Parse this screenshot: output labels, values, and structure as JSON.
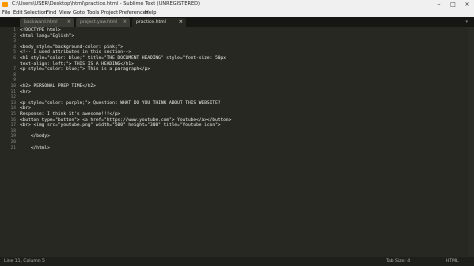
{
  "window": {
    "title": "C:\\Users\\USER\\Desktop\\html\\practice.html - Sublime Text (UNREGISTERED)"
  },
  "menu": [
    "File",
    "Edit",
    "Selection",
    "Find",
    "View",
    "Goto",
    "Tools",
    "Project",
    "Preferences",
    "Help"
  ],
  "tabs": [
    {
      "label": "backward.html",
      "active": false
    },
    {
      "label": "project.yaw.html",
      "active": false
    },
    {
      "label": "practice.html",
      "active": true
    }
  ],
  "editor": {
    "lines": [
      {
        "n": "1",
        "text": "<!DOCTYPE html>"
      },
      {
        "n": "2",
        "text": "<html lang=\"Eglish\">"
      },
      {
        "n": "3",
        "text": ""
      },
      {
        "n": "4",
        "text": "<body style=\"background-color: pink;\">"
      },
      {
        "n": "5",
        "text": "<!-- I used attributes in this section-->"
      },
      {
        "n": "6",
        "text": "<h1 style=\"color: blue;\" title=\"THE DOCUMENT HEADING\" style=\"font-size: 50px"
      },
      {
        "n": "",
        "text": "text-align: left;\"> THIS IS A HEADING</h1>"
      },
      {
        "n": "7",
        "text": "<p style=\"color: blue;\"> This is a paragraph</p>"
      },
      {
        "n": "8",
        "text": ""
      },
      {
        "n": "9",
        "text": ""
      },
      {
        "n": "10",
        "text": "<h2> PERSONAL PREP TIME</h2>"
      },
      {
        "n": "11",
        "text": "<hr>"
      },
      {
        "n": "12",
        "text": ""
      },
      {
        "n": "13",
        "text": "<p style=\"color: purple;\"> Question: WHAT DO YOU THINK ABOUT THIS WEBSITE?"
      },
      {
        "n": "14",
        "text": "<br>"
      },
      {
        "n": "15",
        "text": "Response: I think it's awesome!!!</p>"
      },
      {
        "n": "16",
        "text": "<button type=\"button\"> <a href=\"https://www.youtube.com\"> Youtube</a></button>"
      },
      {
        "n": "17",
        "text": "<br> <img src=\"youtube.png\" width=\"500\" height=\"300\" title=\"Youtube icon\">"
      },
      {
        "n": "18",
        "text": ""
      },
      {
        "n": "19",
        "text": "    </body>"
      },
      {
        "n": "20",
        "text": ""
      },
      {
        "n": "21",
        "text": "    </html>"
      }
    ]
  },
  "status": {
    "position": "Line 11, Column 5",
    "tab_size": "Tab Size: 4",
    "syntax": "HTML"
  }
}
